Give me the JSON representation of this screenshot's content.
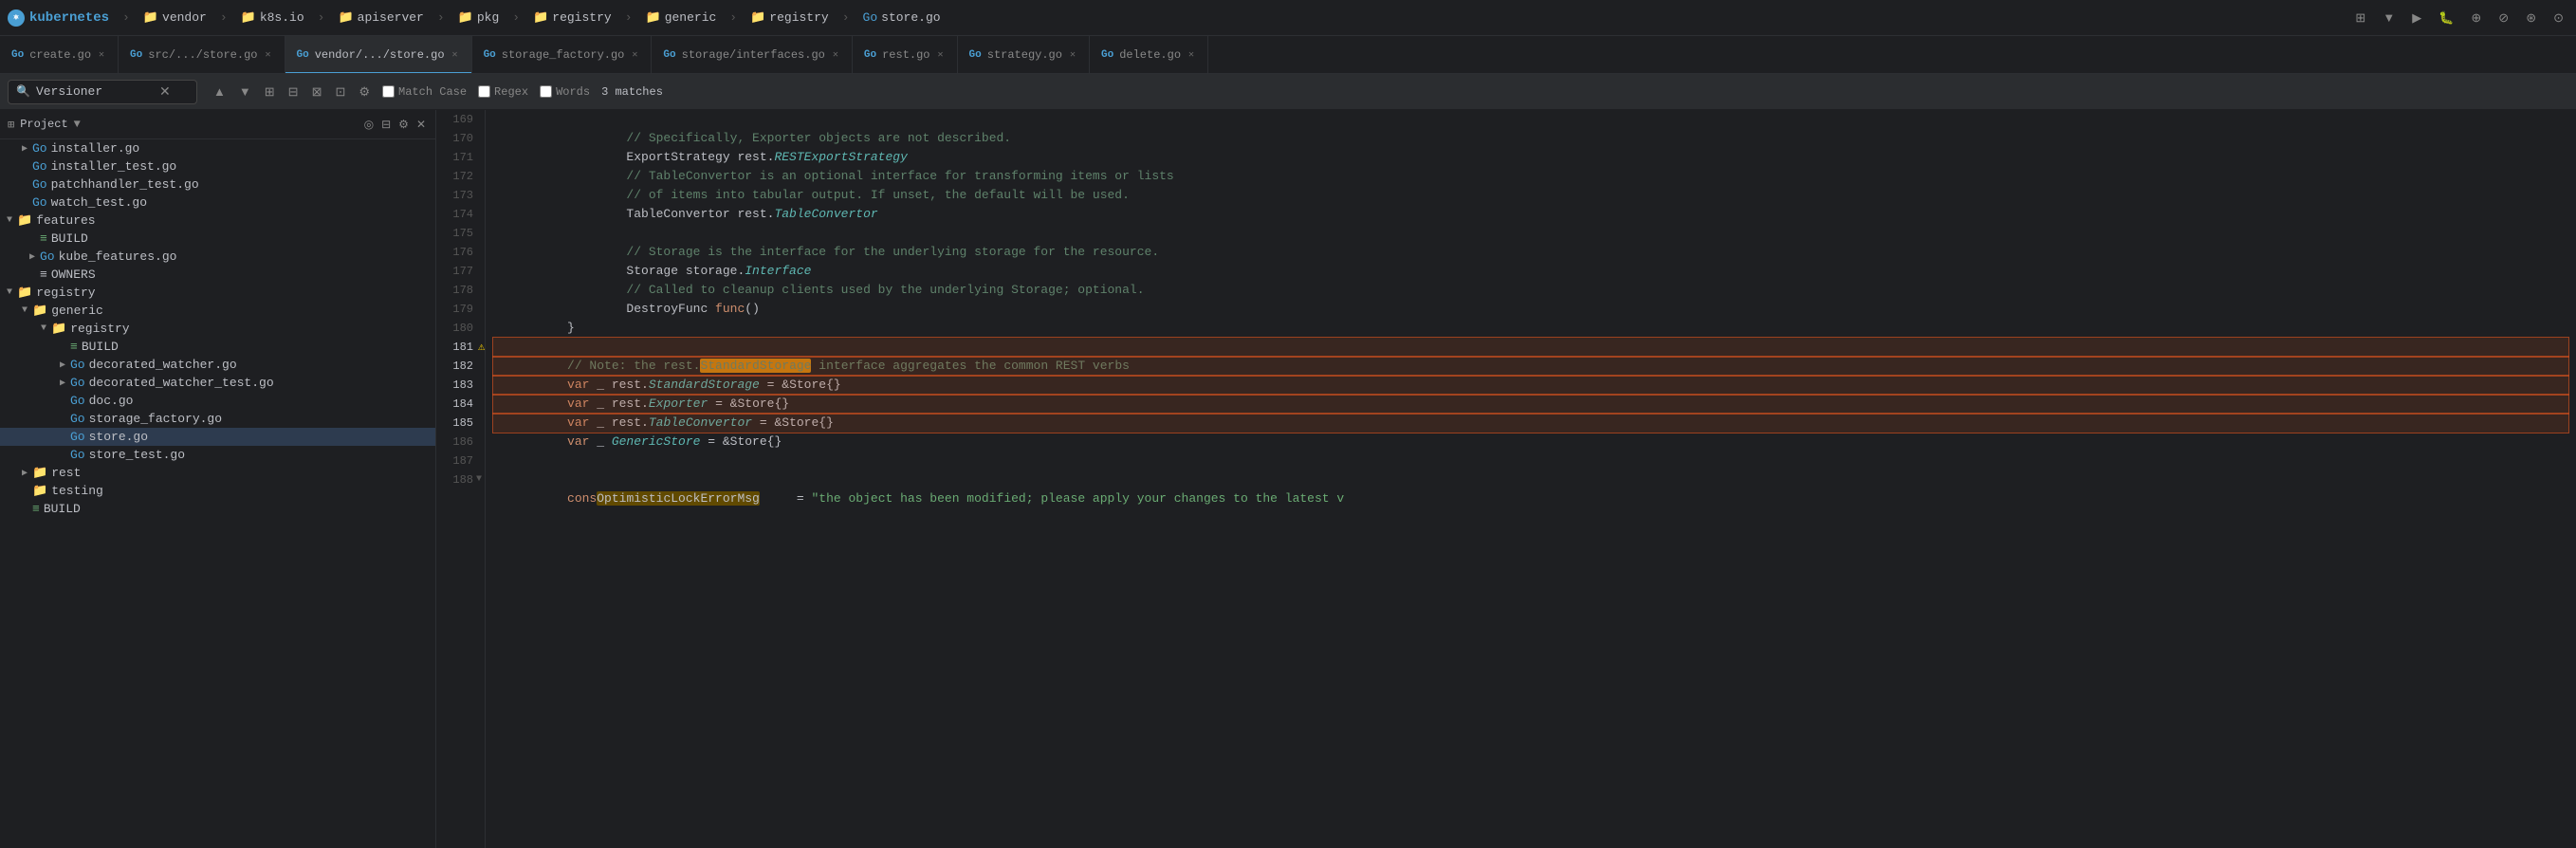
{
  "topbar": {
    "items": [
      {
        "label": "kubernetes",
        "type": "project",
        "icon": "kubernetes-icon"
      },
      {
        "label": "vendor",
        "type": "folder"
      },
      {
        "label": "k8s.io",
        "type": "folder"
      },
      {
        "label": "apiserver",
        "type": "folder"
      },
      {
        "label": "pkg",
        "type": "folder"
      },
      {
        "label": "registry",
        "type": "folder"
      },
      {
        "label": "generic",
        "type": "folder"
      },
      {
        "label": "registry",
        "type": "folder"
      },
      {
        "label": "store.go",
        "type": "file"
      }
    ]
  },
  "tabs": [
    {
      "label": "create.go",
      "active": false,
      "icon": "go"
    },
    {
      "label": "src/.../store.go",
      "active": false,
      "icon": "go"
    },
    {
      "label": "vendor/.../store.go",
      "active": true,
      "icon": "go"
    },
    {
      "label": "storage_factory.go",
      "active": false,
      "icon": "go"
    },
    {
      "label": "storage/interfaces.go",
      "active": false,
      "icon": "go"
    },
    {
      "label": "rest.go",
      "active": false,
      "icon": "go"
    },
    {
      "label": "strategy.go",
      "active": false,
      "icon": "go"
    },
    {
      "label": "delete.go",
      "active": false,
      "icon": "go"
    }
  ],
  "search": {
    "query": "Versioner",
    "placeholder": "Search",
    "match_case": false,
    "regex": false,
    "words": false,
    "match_count": "3 matches",
    "match_case_label": "Match Case",
    "regex_label": "Regex",
    "words_label": "Words"
  },
  "sidebar": {
    "title": "Project",
    "tree": [
      {
        "label": "installer.go",
        "type": "go",
        "depth": 1,
        "expanded": false
      },
      {
        "label": "installer_test.go",
        "type": "go",
        "depth": 1,
        "expanded": false
      },
      {
        "label": "patchhandler_test.go",
        "type": "go",
        "depth": 1,
        "expanded": false
      },
      {
        "label": "watch_test.go",
        "type": "go",
        "depth": 1,
        "expanded": false
      },
      {
        "label": "features",
        "type": "folder",
        "depth": 0,
        "expanded": true
      },
      {
        "label": "BUILD",
        "type": "build",
        "depth": 1,
        "expanded": false
      },
      {
        "label": "kube_features.go",
        "type": "go",
        "depth": 1,
        "expanded": false
      },
      {
        "label": "OWNERS",
        "type": "owners",
        "depth": 1,
        "expanded": false
      },
      {
        "label": "registry",
        "type": "folder",
        "depth": 0,
        "expanded": true
      },
      {
        "label": "generic",
        "type": "folder",
        "depth": 1,
        "expanded": true
      },
      {
        "label": "registry",
        "type": "folder",
        "depth": 2,
        "expanded": true
      },
      {
        "label": "BUILD",
        "type": "build",
        "depth": 3,
        "expanded": false
      },
      {
        "label": "decorated_watcher.go",
        "type": "go",
        "depth": 3,
        "expanded": false
      },
      {
        "label": "decorated_watcher_test.go",
        "type": "go",
        "depth": 3,
        "expanded": false
      },
      {
        "label": "doc.go",
        "type": "go",
        "depth": 3,
        "expanded": false
      },
      {
        "label": "storage_factory.go",
        "type": "go",
        "depth": 3,
        "expanded": false
      },
      {
        "label": "store.go",
        "type": "go",
        "depth": 3,
        "expanded": false,
        "selected": true
      },
      {
        "label": "store_test.go",
        "type": "go",
        "depth": 3,
        "expanded": false
      },
      {
        "label": "rest",
        "type": "folder",
        "depth": 1,
        "expanded": false
      },
      {
        "label": "testing",
        "type": "folder",
        "depth": 1,
        "expanded": false
      },
      {
        "label": "BUILD",
        "type": "build",
        "depth": 1,
        "expanded": false
      }
    ]
  },
  "code": {
    "lines": [
      {
        "num": 169,
        "content": "// Specifically, Exporter objects are not described."
      },
      {
        "num": 170,
        "content": "ExportStrategy rest.RESTExportStrategy"
      },
      {
        "num": 171,
        "content": "// TableConvertor is an optional interface for transforming items or lists"
      },
      {
        "num": 172,
        "content": "// of items into tabular output. If unset, the default will be used."
      },
      {
        "num": 173,
        "content": "TableConvertor rest.TableConvertor"
      },
      {
        "num": 174,
        "content": ""
      },
      {
        "num": 175,
        "content": "// Storage is the interface for the underlying storage for the resource."
      },
      {
        "num": 176,
        "content": "Storage storage.Interface"
      },
      {
        "num": 177,
        "content": "// Called to cleanup clients used by the underlying Storage; optional."
      },
      {
        "num": 178,
        "content": "DestroyFunc func()"
      },
      {
        "num": 179,
        "content": "}"
      },
      {
        "num": 180,
        "content": "",
        "has_caution": true
      },
      {
        "num": 181,
        "content": "// Note: the rest.StandardStorage interface aggregates the common REST verbs",
        "selection_start": true
      },
      {
        "num": 182,
        "content": "var _ rest.StandardStorage = &Store{}",
        "in_selection": true
      },
      {
        "num": 183,
        "content": "var _ rest.Exporter = &Store{}",
        "in_selection": true
      },
      {
        "num": 184,
        "content": "var _ rest.TableConvertor = &Store{}",
        "in_selection": true
      },
      {
        "num": 185,
        "content": "var _ GenericStore = &Store{}",
        "selection_end": true
      },
      {
        "num": 186,
        "content": ""
      },
      {
        "num": 187,
        "content": "const (",
        "has_fold": true
      },
      {
        "num": 188,
        "content": "OptimisticLockErrorMsg     = \"the object has been modified; please apply your changes to the latest v"
      }
    ]
  }
}
